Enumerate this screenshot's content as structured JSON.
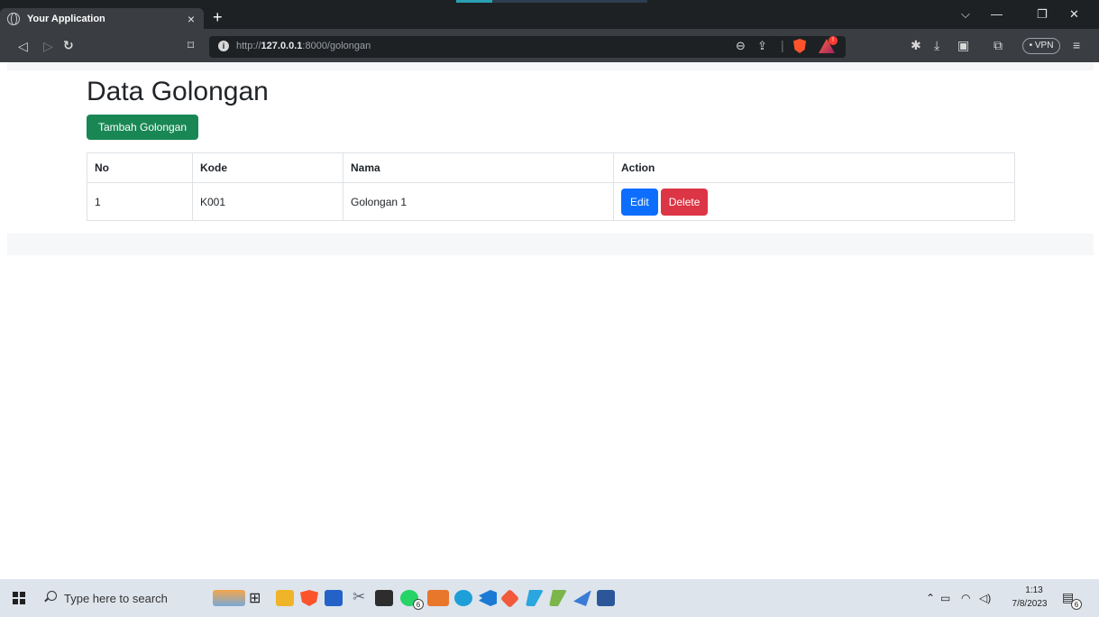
{
  "browser": {
    "tab_title": "Your Application",
    "tab_close": "×",
    "new_tab": "+",
    "url_prefix": "http://",
    "url_host": "127.0.0.1",
    "url_rest": ":8000/golongan",
    "vpn_label": "• VPN",
    "icons": [
      "back-icon",
      "forward-icon",
      "reload-icon",
      "bookmark-icon",
      "zoom-icon",
      "share-icon",
      "brave-shield-icon",
      "brave-rewards-icon",
      "extensions-icon",
      "download-icon",
      "sidebar-icon",
      "wallet-icon",
      "menu-icon"
    ]
  },
  "page": {
    "title": "Data Golongan",
    "add_button": "Tambah Golongan",
    "table": {
      "headers": [
        "No",
        "Kode",
        "Nama",
        "Action"
      ],
      "rows": [
        {
          "no": "1",
          "kode": "K001",
          "nama": "Golongan 1"
        }
      ],
      "edit_label": "Edit",
      "delete_label": "Delete"
    },
    "colors": {
      "success": "#198754",
      "primary": "#0d6efd",
      "danger": "#dc3545"
    }
  },
  "taskbar": {
    "search_placeholder": "Type here to search",
    "time": "1:13",
    "date": "7/8/2023",
    "whatsapp_badge": "6",
    "notification_badge": "6"
  }
}
